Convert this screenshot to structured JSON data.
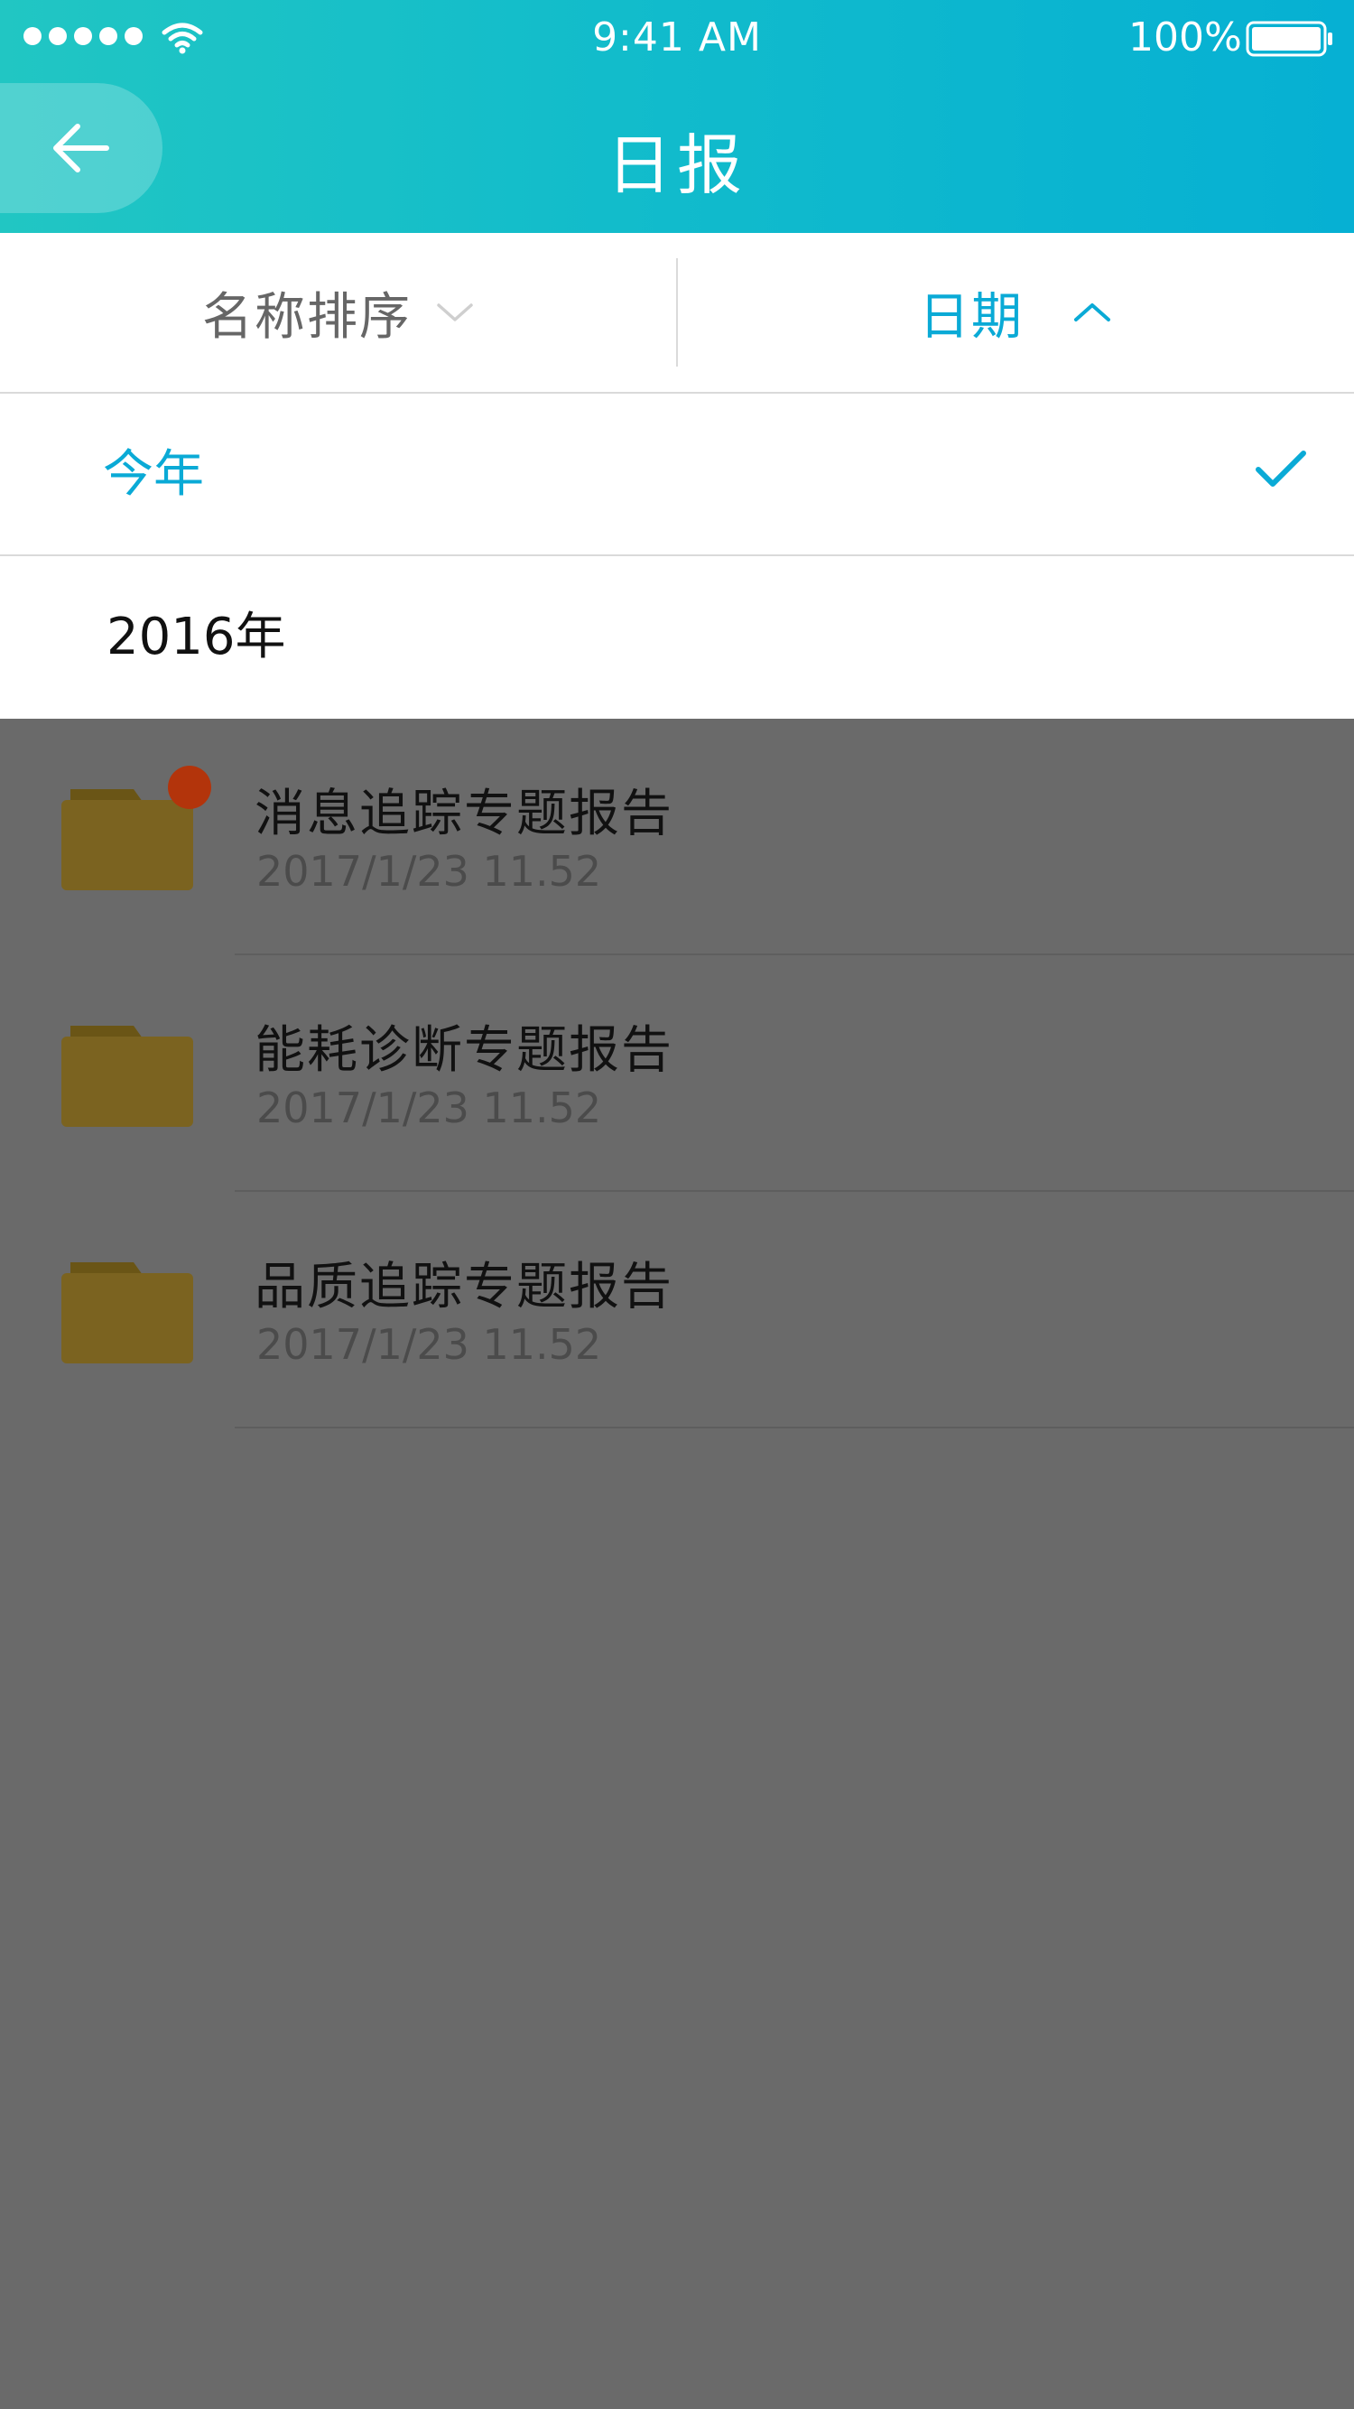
{
  "colors": {
    "accent": "#0aaad6",
    "header_gradient_start": "#21c6c3",
    "header_gradient_end": "#06b0d3",
    "overlay": "#6a6a6a",
    "folder": "#7b6320",
    "badge": "#b3340b"
  },
  "status_bar": {
    "time": "9:41 AM",
    "battery": "100%",
    "icons": [
      "signal-dots",
      "wifi-icon",
      "battery-icon"
    ]
  },
  "header": {
    "title": "日报",
    "back_icon": "arrow-left-icon"
  },
  "filter": {
    "sort_label": "名称排序",
    "sort_icon": "chevron-down-icon",
    "date_label": "日期",
    "date_icon": "chevron-up-icon"
  },
  "dropdown": {
    "options": [
      {
        "label": "今年",
        "selected": true
      },
      {
        "label": "2016年",
        "selected": false
      }
    ]
  },
  "list": {
    "items": [
      {
        "title": "消息追踪专题报告",
        "date": "2017/1/23 11.52",
        "has_badge": true
      },
      {
        "title": "能耗诊断专题报告",
        "date": "2017/1/23 11.52",
        "has_badge": false
      },
      {
        "title": "品质追踪专题报告",
        "date": "2017/1/23 11.52",
        "has_badge": false
      }
    ]
  }
}
